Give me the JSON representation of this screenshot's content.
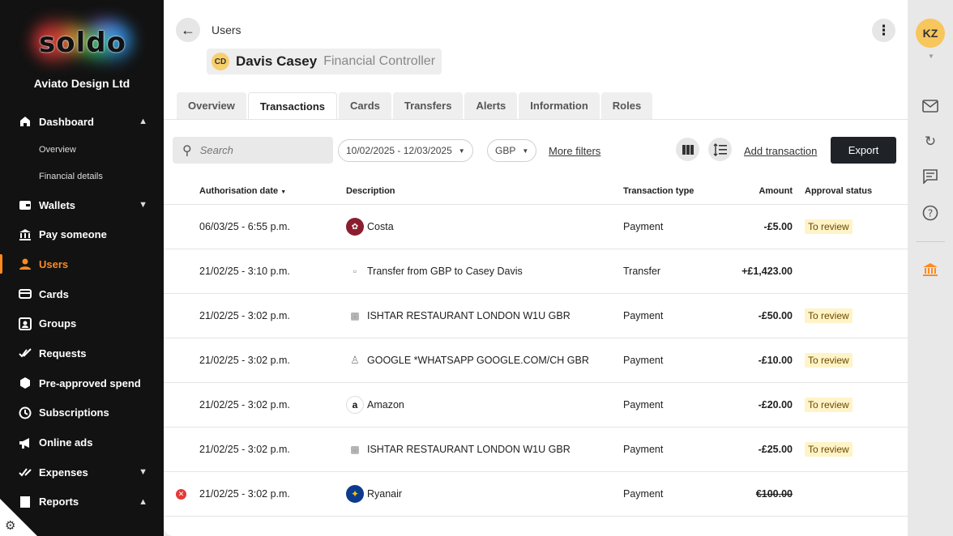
{
  "sidebar": {
    "logo": "soldo",
    "org_name": "Aviato Design Ltd",
    "items": [
      {
        "label": "Dashboard",
        "icon": "home-icon",
        "chevron": "^"
      },
      {
        "label": "Overview",
        "sub": true
      },
      {
        "label": "Financial details",
        "sub": true
      },
      {
        "label": "Wallets",
        "icon": "wallet-icon",
        "chevron": "v"
      },
      {
        "label": "Pay someone",
        "icon": "bank-icon"
      },
      {
        "label": "Users",
        "icon": "user-icon",
        "active": true
      },
      {
        "label": "Cards",
        "icon": "card-icon"
      },
      {
        "label": "Groups",
        "icon": "groups-icon"
      },
      {
        "label": "Requests",
        "icon": "check-icon"
      },
      {
        "label": "Pre-approved spend",
        "icon": "hexagon-icon"
      },
      {
        "label": "Subscriptions",
        "icon": "clock-icon"
      },
      {
        "label": "Online ads",
        "icon": "megaphone-icon"
      },
      {
        "label": "Expenses",
        "icon": "expenses-icon",
        "chevron": "v"
      },
      {
        "label": "Reports",
        "icon": "reports-icon",
        "chevron": "^"
      }
    ]
  },
  "header": {
    "breadcrumb": "Users",
    "user_initials": "CD",
    "user_name": "Davis Casey",
    "user_role": "Financial Controller"
  },
  "tabs": [
    "Overview",
    "Transactions",
    "Cards",
    "Transfers",
    "Alerts",
    "Information",
    "Roles"
  ],
  "active_tab": "Transactions",
  "toolbar": {
    "search_placeholder": "Search",
    "date_range": "10/02/2025 - 12/03/2025",
    "currency": "GBP",
    "more_filters": "More filters",
    "add_transaction": "Add transaction",
    "export": "Export"
  },
  "table": {
    "columns": {
      "date": "Authorisation date",
      "description": "Description",
      "type": "Transaction type",
      "amount": "Amount",
      "status": "Approval status"
    },
    "rows": [
      {
        "date": "06/03/25 - 6:55 p.m.",
        "description": "Costa",
        "icon": "costa-logo-icon",
        "type": "Payment",
        "amount": "-£5.00",
        "status": "To review"
      },
      {
        "date": "21/02/25 - 3:10 p.m.",
        "description": "Transfer from GBP to Casey Davis",
        "icon": "transfer-icon",
        "type": "Transfer",
        "amount": "+£1,423.00",
        "status": ""
      },
      {
        "date": "21/02/25 - 3:02 p.m.",
        "description": "ISHTAR RESTAURANT LONDON W1U GBR",
        "icon": "restaurant-icon",
        "type": "Payment",
        "amount": "-£50.00",
        "status": "To review"
      },
      {
        "date": "21/02/25 - 3:02 p.m.",
        "description": "GOOGLE *WHATSAPP GOOGLE.COM/CH GBR",
        "icon": "person-icon",
        "type": "Payment",
        "amount": "-£10.00",
        "status": "To review"
      },
      {
        "date": "21/02/25 - 3:02 p.m.",
        "description": "Amazon",
        "icon": "amazon-logo-icon",
        "type": "Payment",
        "amount": "-£20.00",
        "status": "To review"
      },
      {
        "date": "21/02/25 - 3:02 p.m.",
        "description": "ISHTAR RESTAURANT LONDON W1U GBR",
        "icon": "restaurant-icon",
        "type": "Payment",
        "amount": "-£25.00",
        "status": "To review"
      },
      {
        "date": "21/02/25 - 3:02 p.m.",
        "description": "Ryanair",
        "icon": "ryanair-logo-icon",
        "type": "Payment",
        "amount": "€100.00",
        "status": "",
        "declined": true
      }
    ]
  },
  "rail": {
    "avatar_initials": "KZ"
  },
  "colors": {
    "accent": "#ff8a1f",
    "sidebar_bg": "#121212",
    "badge_bg": "#fff3c8",
    "error": "#e53935"
  }
}
